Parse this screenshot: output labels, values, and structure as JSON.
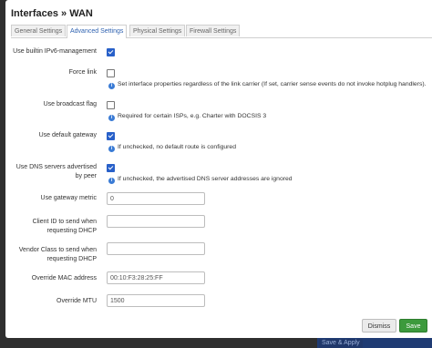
{
  "dialog": {
    "title": "Interfaces » WAN",
    "tabs": [
      "General Settings",
      "Advanced Settings",
      "Physical Settings",
      "Firewall Settings"
    ],
    "active_tab": "Advanced Settings"
  },
  "fields": {
    "ipv6_mgmt": {
      "label": "Use builtin IPv6-management",
      "checked": true
    },
    "force_link": {
      "label": "Force link",
      "checked": false,
      "help": "Set interface properties regardless of the link carrier (If set, carrier sense events do not invoke hotplug handlers)."
    },
    "broadcast_flag": {
      "label": "Use broadcast flag",
      "checked": false,
      "help": "Required for certain ISPs, e.g. Charter with DOCSIS 3"
    },
    "default_gateway": {
      "label": "Use default gateway",
      "checked": true,
      "help": "If unchecked, no default route is configured"
    },
    "peer_dns": {
      "label_line1": "Use DNS servers advertised",
      "label_line2": "by peer",
      "checked": true,
      "help": "If unchecked, the advertised DNS server addresses are ignored"
    },
    "gateway_metric": {
      "label": "Use gateway metric",
      "value": "0"
    },
    "client_id": {
      "label_line1": "Client ID to send when",
      "label_line2": "requesting DHCP",
      "value": ""
    },
    "vendor_class": {
      "label_line1": "Vendor Class to send when",
      "label_line2": "requesting DHCP",
      "value": ""
    },
    "mac_override": {
      "label": "Override MAC address",
      "value": "00:10:F3:28:25:FF"
    },
    "mtu": {
      "label": "Override MTU",
      "value": "1500"
    }
  },
  "footer": {
    "dismiss_label": "Dismiss",
    "save_label": "Save"
  },
  "background": {
    "save_apply_label": "Save & Apply"
  },
  "colors": {
    "accent": "#2860c9",
    "save": "#3c9a3c",
    "info": "#3a7bd5"
  }
}
